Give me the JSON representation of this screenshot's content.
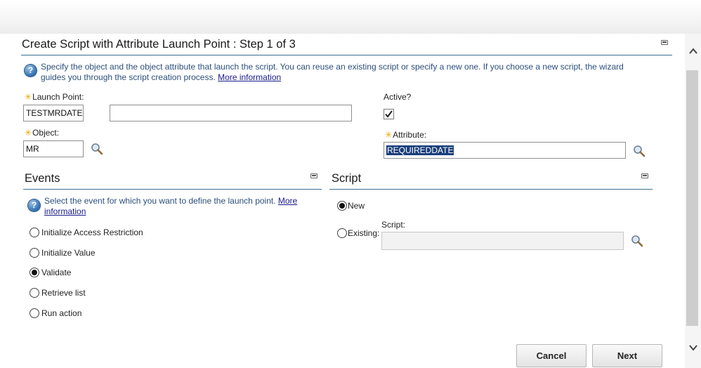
{
  "dialog": {
    "title": "Create Script with Attribute Launch Point : Step 1 of 3",
    "help_text": "Specify the object and the object attribute that launch the script. You can reuse an existing script or specify a new one. If you choose a new script, the wizard guides you through the script creation process.",
    "help_link": "More information"
  },
  "fields": {
    "launch_point_label": "Launch Point:",
    "launch_point_value": "TESTMRDATE",
    "launch_point_description": "",
    "object_label": "Object:",
    "object_value": "MR",
    "active_label": "Active?",
    "active_checked": true,
    "attribute_label": "Attribute:",
    "attribute_value": "REQUIREDDATE"
  },
  "events": {
    "title": "Events",
    "help_text": "Select the event for which you want to define the launch point.",
    "help_link_1": "More",
    "help_link_2": "information",
    "options": [
      {
        "label": "Initialize Access Restriction",
        "selected": false
      },
      {
        "label": "Initialize Value",
        "selected": false
      },
      {
        "label": "Validate",
        "selected": true
      },
      {
        "label": "Retrieve list",
        "selected": false
      },
      {
        "label": "Run action",
        "selected": false
      }
    ]
  },
  "script": {
    "title": "Script",
    "new_label": "New",
    "new_selected": true,
    "existing_label": "Existing:",
    "script_label": "Script:",
    "script_value": ""
  },
  "buttons": {
    "cancel": "Cancel",
    "next": "Next"
  },
  "colors": {
    "rule": "#3b6e8f",
    "help_text": "#2c4f7c",
    "required_star": "#e8a400",
    "selection": "#1a3e7a"
  }
}
